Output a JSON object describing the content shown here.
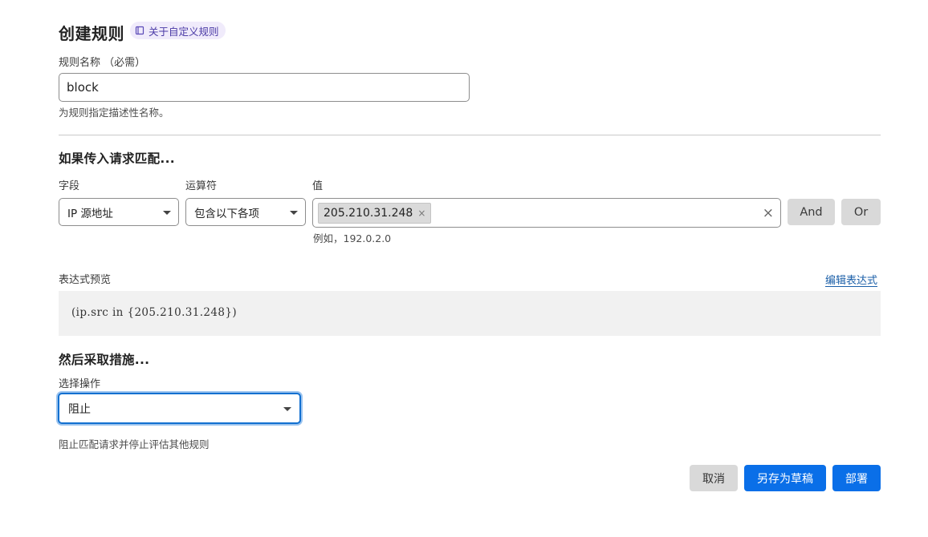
{
  "header": {
    "title": "创建规则",
    "doc_link": "关于自定义规则"
  },
  "rule_name": {
    "label": "规则名称 （必需）",
    "value": "block",
    "help": "为规则指定描述性名称。"
  },
  "match": {
    "section_title": "如果传入请求匹配...",
    "field_label": "字段",
    "field_value": "IP 源地址",
    "operator_label": "运算符",
    "operator_value": "包含以下各项",
    "value_label": "值",
    "value_tag": "205.210.31.248",
    "value_example": "例如，192.0.2.0",
    "and_label": "And",
    "or_label": "Or"
  },
  "expression": {
    "label": "表达式预览",
    "edit_link": "编辑表达式",
    "code": "(ip.src in {205.210.31.248})"
  },
  "action": {
    "section_title": "然后采取措施...",
    "select_label": "选择操作",
    "select_value": "阻止",
    "help": "阻止匹配请求并停止评估其他规则"
  },
  "footer": {
    "cancel": "取消",
    "save_draft": "另存为草稿",
    "deploy": "部署"
  }
}
